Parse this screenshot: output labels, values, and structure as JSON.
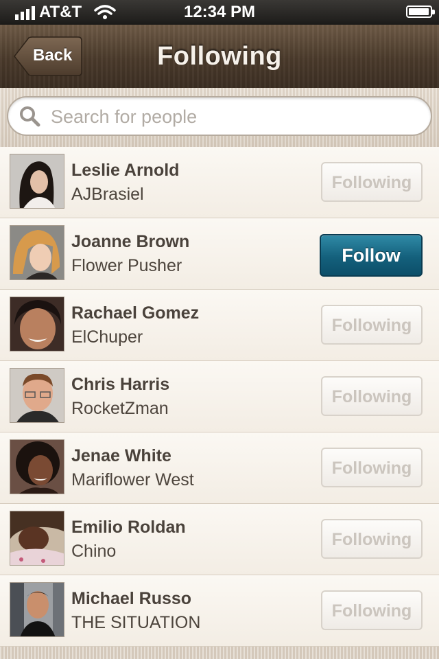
{
  "status_bar": {
    "carrier": "AT&T",
    "time": "12:34 PM",
    "battery_level": 0.95
  },
  "nav": {
    "back_label": "Back",
    "title": "Following"
  },
  "search": {
    "placeholder": "Search for people",
    "value": ""
  },
  "people": [
    {
      "name": "Leslie Arnold",
      "handle": "AJBrasiel",
      "button": "Following",
      "state": "following"
    },
    {
      "name": "Joanne Brown",
      "handle": "Flower Pusher",
      "button": "Follow",
      "state": "follow"
    },
    {
      "name": "Rachael Gomez",
      "handle": "ElChuper",
      "button": "Following",
      "state": "following"
    },
    {
      "name": "Chris Harris",
      "handle": "RocketZman",
      "button": "Following",
      "state": "following"
    },
    {
      "name": "Jenae White",
      "handle": "Mariflower West",
      "button": "Following",
      "state": "following"
    },
    {
      "name": "Emilio Roldan",
      "handle": "Chino",
      "button": "Following",
      "state": "following"
    },
    {
      "name": "Michael Russo",
      "handle": "THE SITUATION",
      "button": "Following",
      "state": "following"
    }
  ],
  "colors": {
    "follow_button": "#14607c",
    "nav_bar": "#4a3a2b",
    "following_text": "#cbc5be"
  }
}
